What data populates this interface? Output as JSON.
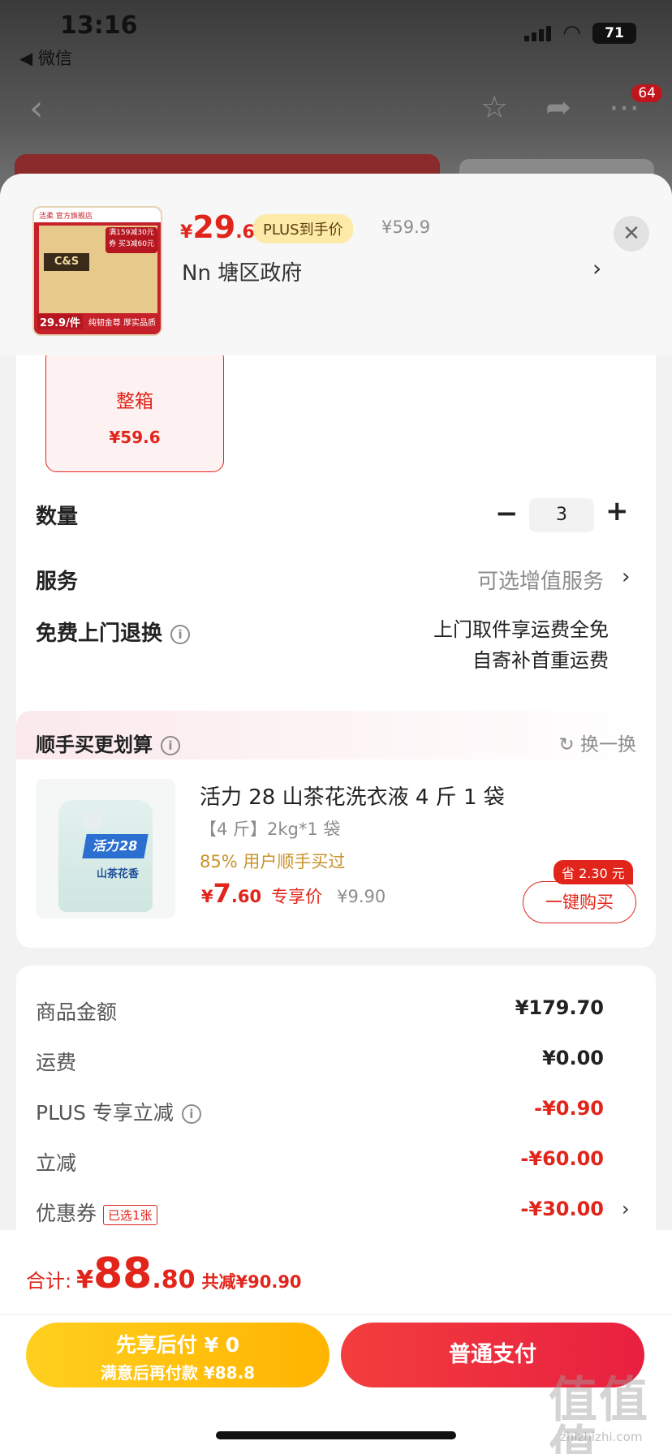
{
  "status_bar": {
    "time": "13:16",
    "back_app": "◀ 微信",
    "battery": "71"
  },
  "nav": {
    "badge": "64"
  },
  "product": {
    "price_symbol": "¥",
    "price_int": "29",
    "price_dec": ".6",
    "plus_badge": "PLUS到手价",
    "original_price": "¥59.9",
    "thumb_brand": "C&S",
    "thumb_store": "洁柔 官方旗舰店",
    "thumb_promo": "满159减30元券 买3减60元",
    "thumb_price": "29.9/件",
    "thumb_slogan": "纯韧金尊 厚实品质"
  },
  "address": {
    "text": "Nn  塘区政府"
  },
  "spec": {
    "name": "整箱",
    "price": "¥59.6"
  },
  "quantity": {
    "label": "数量",
    "value": "3",
    "minus": "−",
    "plus": "+"
  },
  "service": {
    "label": "服务",
    "value": "可选增值服务"
  },
  "returns": {
    "label": "免费上门退换",
    "line1": "上门取件享运费全免",
    "line2": "自寄补首重运费"
  },
  "addon": {
    "title": "顺手买更划算",
    "refresh": "换一换",
    "product_name": "活力 28 山茶花洗衣液 4 斤 1 袋",
    "spec": "【4 斤】2kg*1 袋",
    "social": "85% 用户顺手买过",
    "price_symbol": "¥",
    "price_int": "7",
    "price_dec": ".60",
    "price_tag": "专享价",
    "original_price": "¥9.90",
    "save_badge": "省 2.30 元",
    "buy_button": "一键购买",
    "img_brand": "活力28",
    "img_name": "山茶花香"
  },
  "costs": [
    {
      "label": "商品金额",
      "value": "¥179.70"
    },
    {
      "label": "运费",
      "value": "¥0.00"
    },
    {
      "label": "PLUS 专享立减",
      "value": "-¥0.90"
    },
    {
      "label": "立减",
      "value": "-¥60.00"
    },
    {
      "label": "优惠券",
      "value": "-¥30.00",
      "tag": "已选1张"
    }
  ],
  "total": {
    "label": "合计:",
    "symbol": "¥",
    "int": "88",
    "dec": ".80",
    "discount": "共减¥90.90"
  },
  "buttons": {
    "later_line1": "先享后付 ¥ 0",
    "later_line2": "满意后再付款 ¥88.8",
    "normal": "普通支付"
  },
  "watermark": {
    "main": "值值值",
    "sub": "zhizhizhi.com"
  },
  "colors": {
    "accent": "#e1251b",
    "plus_badge_bg": "#fde9a8",
    "later_button": "#ffc400",
    "normal_button": "#f0303a"
  }
}
